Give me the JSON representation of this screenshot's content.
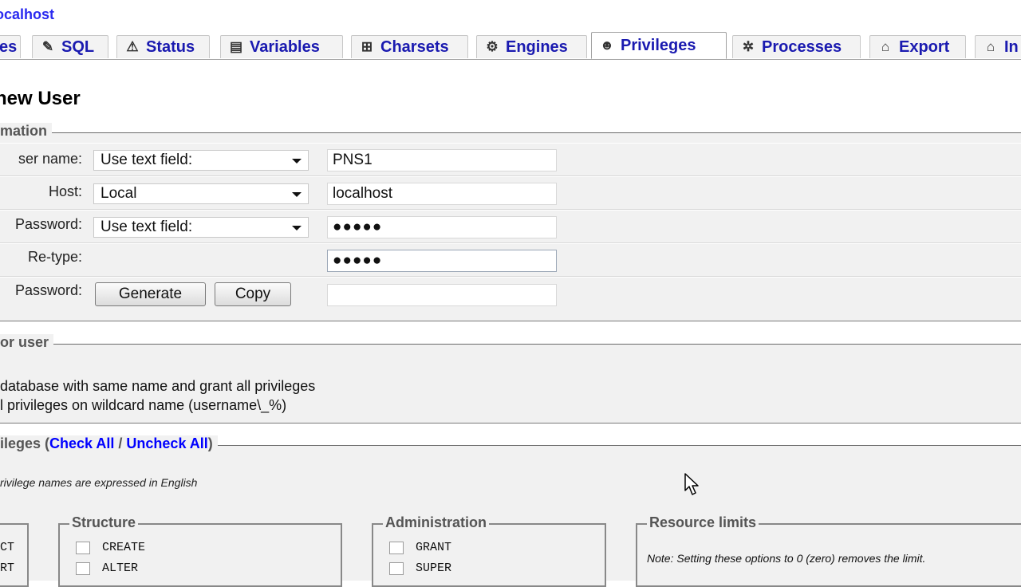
{
  "breadcrumb": "ocalhost",
  "tabs": [
    {
      "label": "es",
      "icon": "none"
    },
    {
      "label": "SQL",
      "icon": "sql-icon"
    },
    {
      "label": "Status",
      "icon": "status-icon"
    },
    {
      "label": "Variables",
      "icon": "variables-icon"
    },
    {
      "label": "Charsets",
      "icon": "charsets-icon"
    },
    {
      "label": "Engines",
      "icon": "engines-icon"
    },
    {
      "label": "Privileges",
      "icon": "privileges-icon"
    },
    {
      "label": "Processes",
      "icon": "processes-icon"
    },
    {
      "label": "Export",
      "icon": "export-icon"
    },
    {
      "label": "In",
      "icon": "import-icon"
    }
  ],
  "active_tab": "Privileges",
  "page_title": "new User",
  "login": {
    "legend": "mation",
    "user_label": "ser name:",
    "user_select": "Use text field:",
    "user_value": "PNS1",
    "host_label": "Host:",
    "host_select": "Local",
    "host_value": "localhost",
    "password_label": "Password:",
    "password_select": "Use text field:",
    "password_value": "●●●●●",
    "retype_label": "Re-type:",
    "retype_value": "●●●●●",
    "generate_label": "Password:",
    "generate_button": "Generate",
    "copy_button": "Copy",
    "generated_value": ""
  },
  "database": {
    "legend": "or user",
    "option1": "database with same name and grant all privileges",
    "option2": "l privileges on wildcard name (username\\_%)"
  },
  "privileges": {
    "legend_prefix": "ileges (",
    "check_all": "Check All",
    "separator": " / ",
    "uncheck_all": "Uncheck All",
    "legend_suffix": ")",
    "note": "rivilege names are expressed in English",
    "data_items": [
      "CT",
      "RT"
    ],
    "structure_legend": "Structure",
    "structure_items": [
      "CREATE",
      "ALTER"
    ],
    "admin_legend": "Administration",
    "admin_items": [
      "GRANT",
      "SUPER"
    ],
    "limits_legend": "Resource limits",
    "limits_note": "Note: Setting these options to 0 (zero) removes the limit."
  }
}
